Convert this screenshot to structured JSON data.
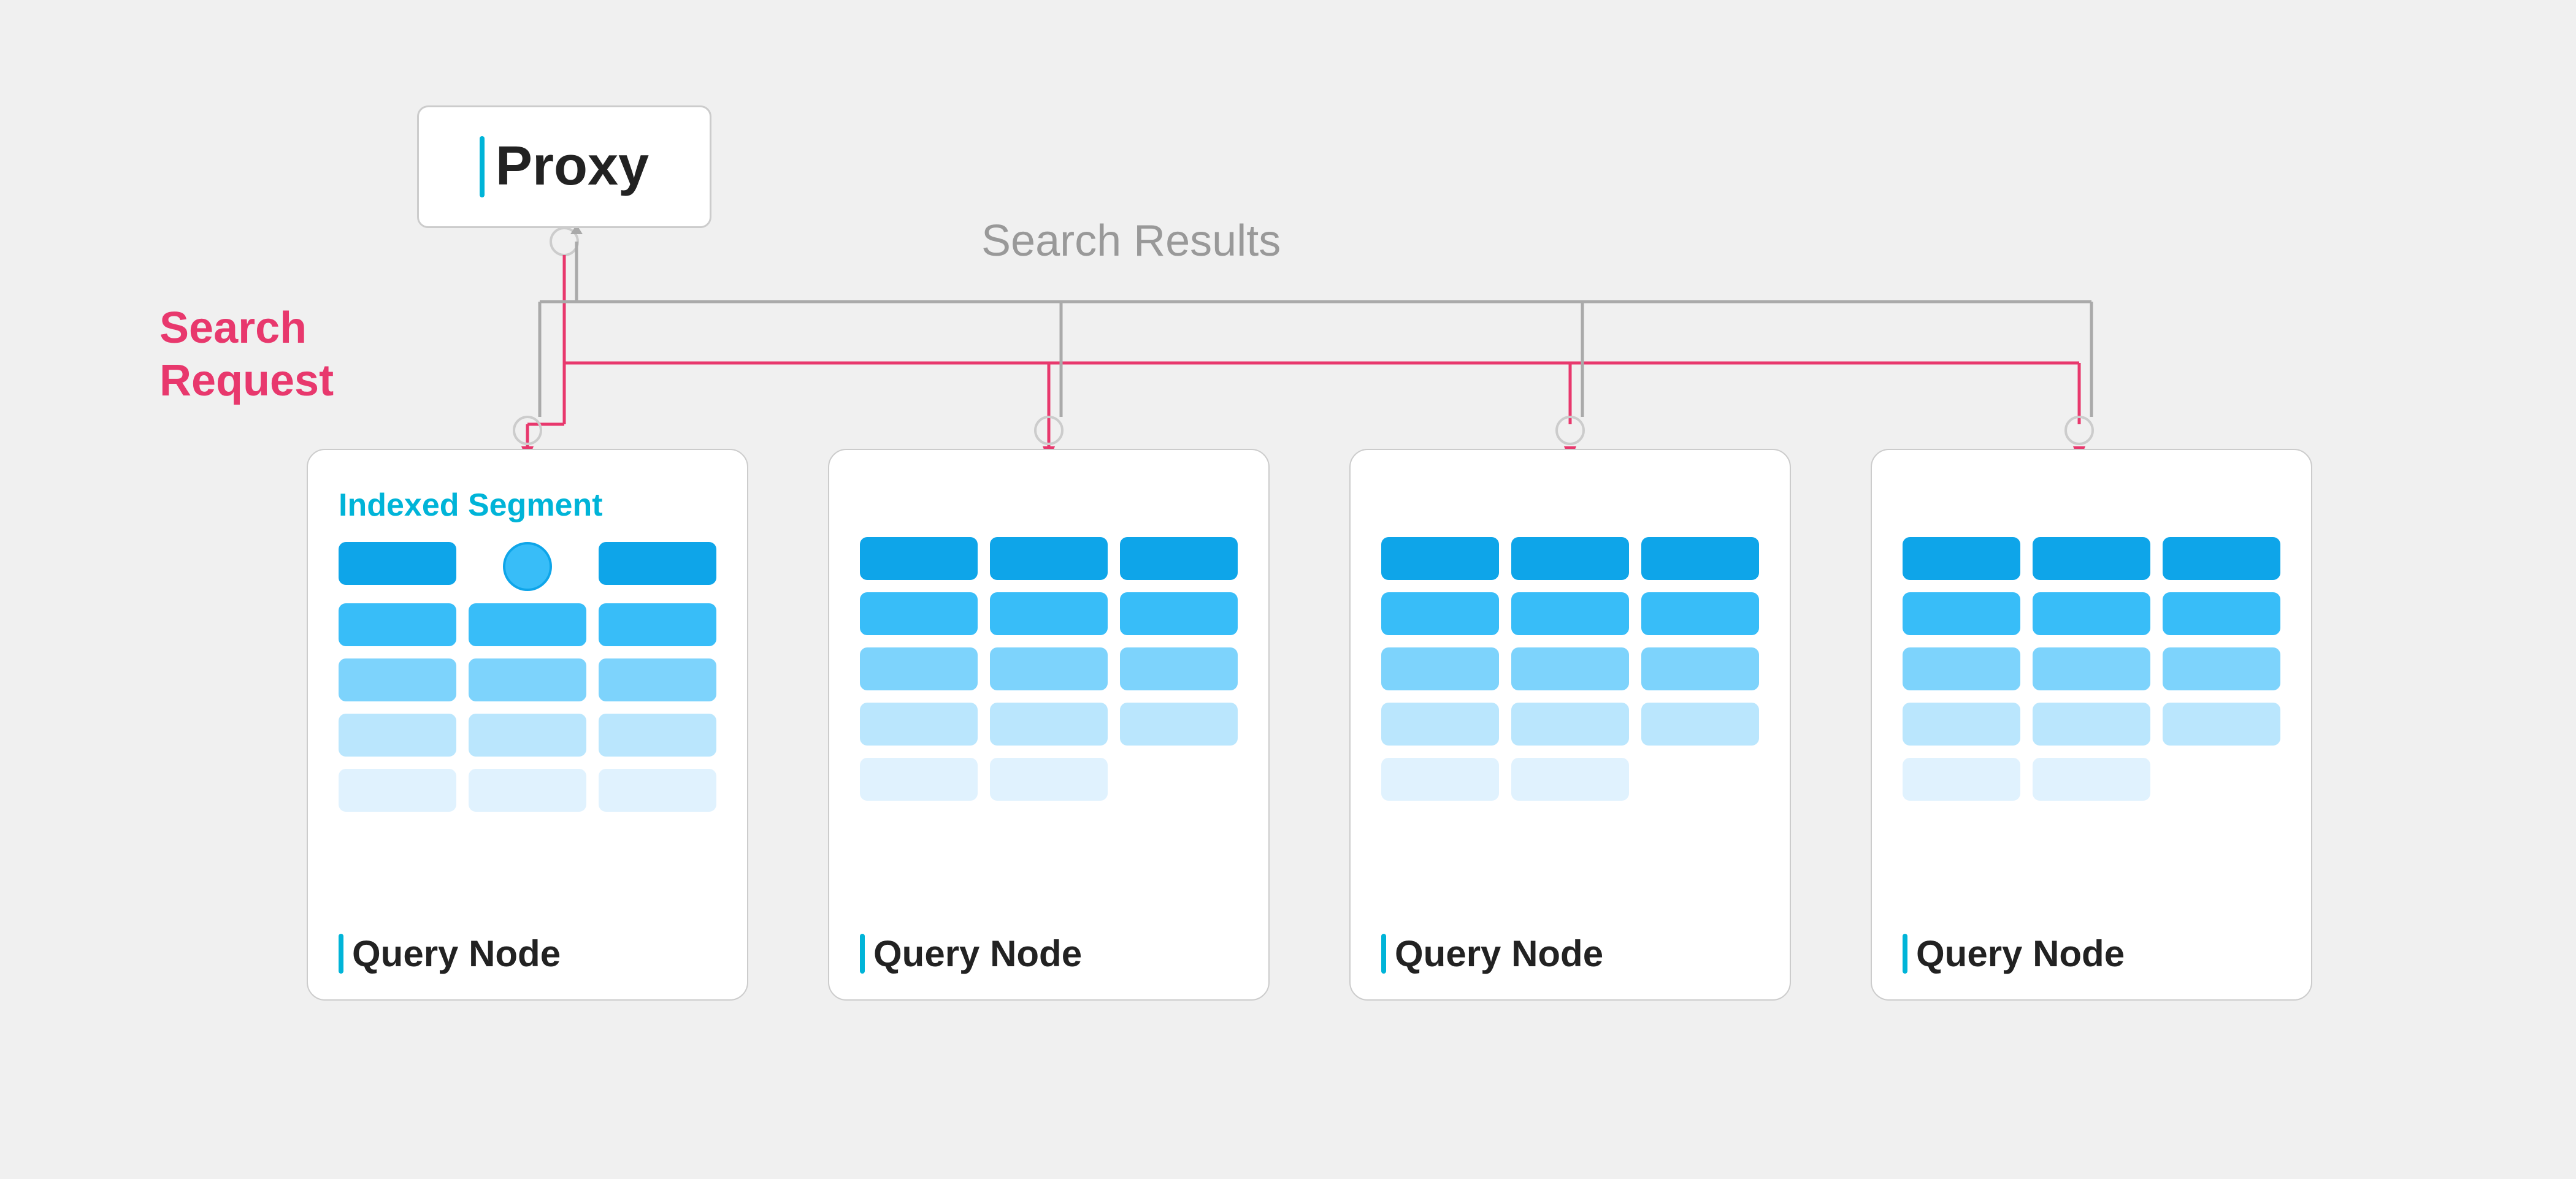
{
  "proxy": {
    "label": "Proxy",
    "cursor": "|"
  },
  "labels": {
    "search_request": "Search\nRequest",
    "search_results": "Search Results"
  },
  "nodes": [
    {
      "label": "Query Node",
      "indexed_segment": "Indexed Segment",
      "has_indexed": true
    },
    {
      "label": "Query Node",
      "has_indexed": false
    },
    {
      "label": "Query Node",
      "has_indexed": false
    },
    {
      "label": "Query Node",
      "has_indexed": false
    }
  ],
  "colors": {
    "accent_cyan": "#00b4d8",
    "accent_pink": "#e8386d",
    "arrow_gray": "#999999",
    "background": "#f0f0f0"
  }
}
